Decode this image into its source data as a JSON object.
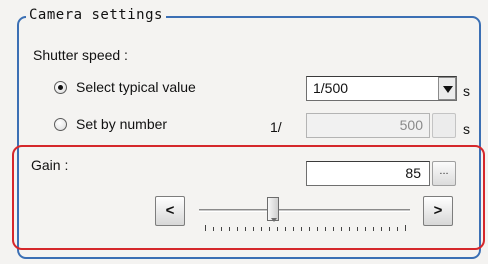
{
  "camera_settings": {
    "title": "Camera settings",
    "shutter_speed": {
      "label": "Shutter speed :",
      "select_typical_label": "Select typical value",
      "select_typical_checked": true,
      "typical_value": "1/500",
      "typical_unit": "s",
      "set_by_number_label": "Set by number",
      "set_by_number_checked": false,
      "number_prefix": "1/",
      "number_value": "500",
      "number_unit": "s",
      "number_button": ""
    },
    "gain": {
      "label": "Gain :",
      "value": "85",
      "ellipsis_button": "...",
      "decrement_label": "<",
      "increment_label": ">",
      "slider_min": 0,
      "slider_max": 250,
      "slider_value": 85,
      "tick_count": 26
    }
  },
  "colors": {
    "group_border": "#3b6fb4",
    "highlight_border": "#d5272b",
    "background": "#f4f3f1"
  }
}
